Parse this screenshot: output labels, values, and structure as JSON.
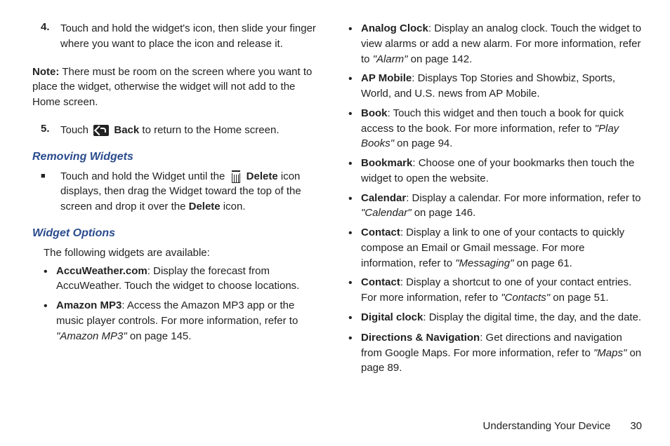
{
  "col1": {
    "step4": {
      "num": "4.",
      "text": "Touch and hold the widget's icon, then slide your finger where you want to place the icon and release it."
    },
    "note": {
      "label": "Note:",
      "text": "There must be room on the screen where you want to place the widget, otherwise the widget will not add to the Home screen."
    },
    "step5": {
      "num": "5.",
      "prefix": "Touch ",
      "bold": "Back",
      "suffix": " to return to the Home screen."
    },
    "removing_head": "Removing Widgets",
    "removing_item": {
      "pre": "Touch and hold the Widget until the ",
      "bold1": "Delete",
      "mid": " icon displays, then drag the Widget toward the top of the screen and drop it over the ",
      "bold2": "Delete",
      "post": " icon."
    },
    "options_head": "Widget Options",
    "options_intro": "The following widgets are available:",
    "bullets": [
      {
        "bold": "AccuWeather.com",
        "text": ": Display the forecast from AccuWeather. Touch the widget to choose locations."
      },
      {
        "bold": "Amazon MP3",
        "text": ": Access the Amazon MP3 app or the music player controls. For more information, refer to ",
        "ital": "\"Amazon MP3\"",
        "after": "  on page 145."
      }
    ]
  },
  "col2": {
    "bullets": [
      {
        "bold": "Analog Clock",
        "text": ": Display an analog clock. Touch the widget to view alarms or add a new alarm. For more information, refer to ",
        "ital": "\"Alarm\"",
        "after": "  on page 142."
      },
      {
        "bold": "AP Mobile",
        "text": ": Displays Top Stories and Showbiz, Sports, World, and U.S. news from AP Mobile."
      },
      {
        "bold": "Book",
        "text": ": Touch this widget and then touch a book for quick access to the book. For more information, refer to ",
        "ital": "\"Play Books\"",
        "after": "  on page 94."
      },
      {
        "bold": "Bookmark",
        "text": ": Choose one of your bookmarks then touch the widget to open the website."
      },
      {
        "bold": "Calendar",
        "text": ": Display a calendar. For more information, refer to ",
        "ital": "\"Calendar\"",
        "after": "  on page 146."
      },
      {
        "bold": "Contact",
        "text": ": Display a link to one of your contacts to quickly compose an Email or Gmail message. For more information, refer to ",
        "ital": "\"Messaging\"",
        "after": "  on page 61."
      },
      {
        "bold": "Contact",
        "text": ": Display a shortcut to one of your contact entries. For more information, refer to ",
        "ital": "\"Contacts\"",
        "after": "  on page 51."
      },
      {
        "bold": "Digital clock",
        "text": ": Display the digital time, the day, and the date."
      },
      {
        "bold": "Directions & Navigation",
        "text": ": Get directions and navigation from Google Maps. For more information, refer to ",
        "ital": "\"Maps\"",
        "after": "  on page 89."
      }
    ]
  },
  "footer": {
    "section": "Understanding Your Device",
    "page": "30"
  }
}
